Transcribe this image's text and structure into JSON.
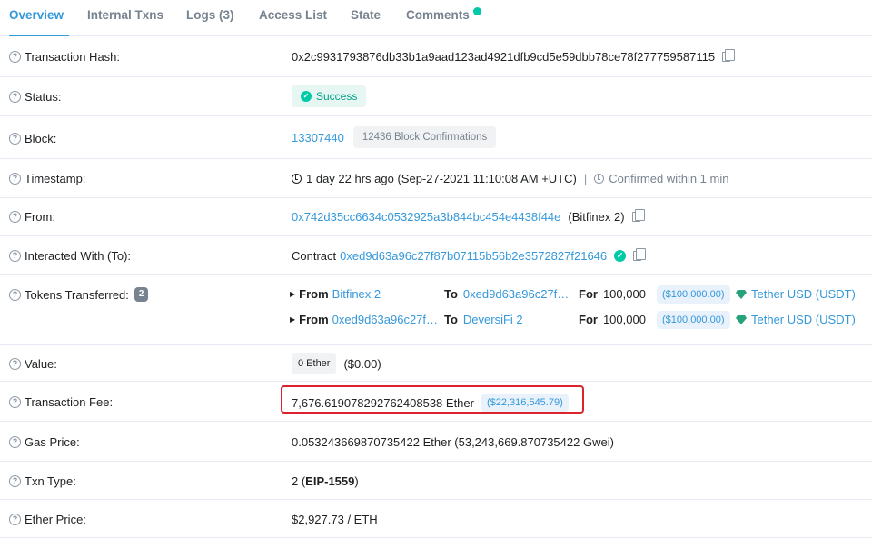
{
  "tabs": [
    {
      "label": "Overview"
    },
    {
      "label": "Internal Txns"
    },
    {
      "label": "Logs (3)"
    },
    {
      "label": "Access List"
    },
    {
      "label": "State"
    },
    {
      "label": "Comments"
    }
  ],
  "rows": {
    "hash": {
      "label": "Transaction Hash:",
      "value": "0x2c9931793876db33b1a9aad123ad4921dfb9cd5e59dbb78ce78f277759587115"
    },
    "status": {
      "label": "Status:",
      "value": "Success"
    },
    "block": {
      "label": "Block:",
      "value": "13307440",
      "confirmations": "12436 Block Confirmations"
    },
    "timestamp": {
      "label": "Timestamp:",
      "value": "1 day 22 hrs ago (Sep-27-2021 11:10:08 AM +UTC)",
      "separator": "|",
      "confirmed": "Confirmed within 1 min"
    },
    "from": {
      "label": "From:",
      "address": "0x742d35cc6634c0532925a3b844bc454e4438f44e",
      "name": "(Bitfinex 2)"
    },
    "to": {
      "label": "Interacted With (To):",
      "prefix": "Contract",
      "address": "0xed9d63a96c27f87b07115b56b2e3572827f21646"
    },
    "tokens": {
      "label": "Tokens Transferred:",
      "count": "2",
      "transfers": [
        {
          "from_kw": "From",
          "from": "Bitfinex 2",
          "to_kw": "To",
          "to": "0xed9d63a96c27f…",
          "for_kw": "For",
          "amount": "100,000",
          "usd": "($100,000.00)",
          "token": "Tether USD (USDT)"
        },
        {
          "from_kw": "From",
          "from": "0xed9d63a96c27f…",
          "to_kw": "To",
          "to": "DeversiFi 2",
          "for_kw": "For",
          "amount": "100,000",
          "usd": "($100,000.00)",
          "token": "Tether USD (USDT)"
        }
      ]
    },
    "value": {
      "label": "Value:",
      "amount": "0 Ether",
      "usd": "($0.00)"
    },
    "fee": {
      "label": "Transaction Fee:",
      "amount": "7,676.619078292762408538 Ether",
      "usd": "($22,316,545.79)"
    },
    "gas": {
      "label": "Gas Price:",
      "value": "0.053243669870735422 Ether (53,243,669.870735422 Gwei)"
    },
    "txtype": {
      "label": "Txn Type:",
      "num": "2 (",
      "name": "EIP-1559",
      "close": ")"
    },
    "ether_price": {
      "label": "Ether Price:",
      "value": "$2,927.73 / ETH"
    }
  },
  "colors": {
    "accent": "#3498db",
    "success": "#00c9a7",
    "highlight": "#d9242f"
  }
}
